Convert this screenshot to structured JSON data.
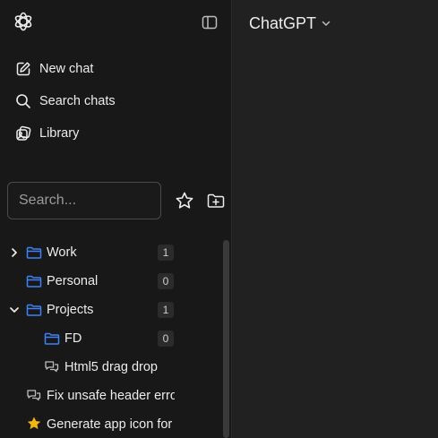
{
  "header": {
    "model_name": "ChatGPT"
  },
  "sidebar": {
    "nav": [
      {
        "label": "New chat",
        "icon": "edit-icon"
      },
      {
        "label": "Search chats",
        "icon": "search-icon"
      },
      {
        "label": "Library",
        "icon": "library-icon"
      }
    ],
    "search": {
      "placeholder": "Search..."
    },
    "tree": [
      {
        "label": "Work",
        "type": "folder",
        "count": "1",
        "expanded": false
      },
      {
        "label": "Personal",
        "type": "folder",
        "count": "0"
      },
      {
        "label": "Projects",
        "type": "folder",
        "count": "1",
        "expanded": true
      },
      {
        "label": "FD",
        "type": "folder",
        "count": "0"
      },
      {
        "label": "Html5 drag drop",
        "type": "chat"
      },
      {
        "label": "Fix unsafe header erro",
        "type": "chat"
      },
      {
        "label": "Generate app icon for",
        "type": "starred-chat"
      }
    ]
  },
  "colors": {
    "folder_icon": "#3b82f6",
    "star": "#f5b60a",
    "sidebar_bg": "#181818",
    "main_bg": "#212121"
  }
}
